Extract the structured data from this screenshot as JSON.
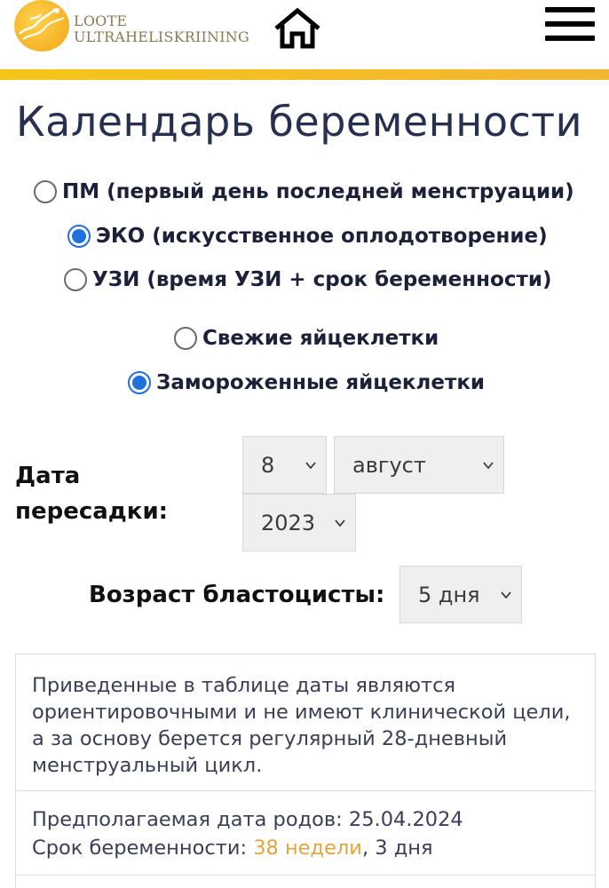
{
  "header": {
    "logo_line1": "LOOTE",
    "logo_line2": "ULTRAHELISKRIINING",
    "accent_color": "#f5c518"
  },
  "page_title": "Календарь беременности",
  "method_options": [
    {
      "label": "ПМ (первый день последней менструации)",
      "checked": false
    },
    {
      "label": "ЭКО (искусственное оплодотворение)",
      "checked": true
    },
    {
      "label": "УЗИ (время УЗИ + срок беременности)",
      "checked": false
    }
  ],
  "egg_options": [
    {
      "label": "Свежие яйцеклетки",
      "checked": false
    },
    {
      "label": "Замороженные яйцеклетки",
      "checked": true
    }
  ],
  "transfer": {
    "label_line1": "Дата",
    "label_line2": "пересадки:",
    "day": "8",
    "month": "август",
    "year": "2023"
  },
  "blastocyst": {
    "label": "Возраст бластоцисты:",
    "value": "5 дня"
  },
  "info": {
    "disclaimer": "Приведенные в таблице даты являются ориентировочными и не имеют клинической цели, а за основу берется регулярный 28-дневный менструальный цикл.",
    "due_date_label": "Предполагаемая дата родов:",
    "due_date": "25.04.2024",
    "term_label": "Срок беременности:",
    "term_weeks": "38 недели",
    "term_sep": ",",
    "term_days": "3 дня",
    "accent_color": "#e2a53a"
  },
  "icons": {
    "home": "home-icon",
    "menu": "menu-icon"
  }
}
